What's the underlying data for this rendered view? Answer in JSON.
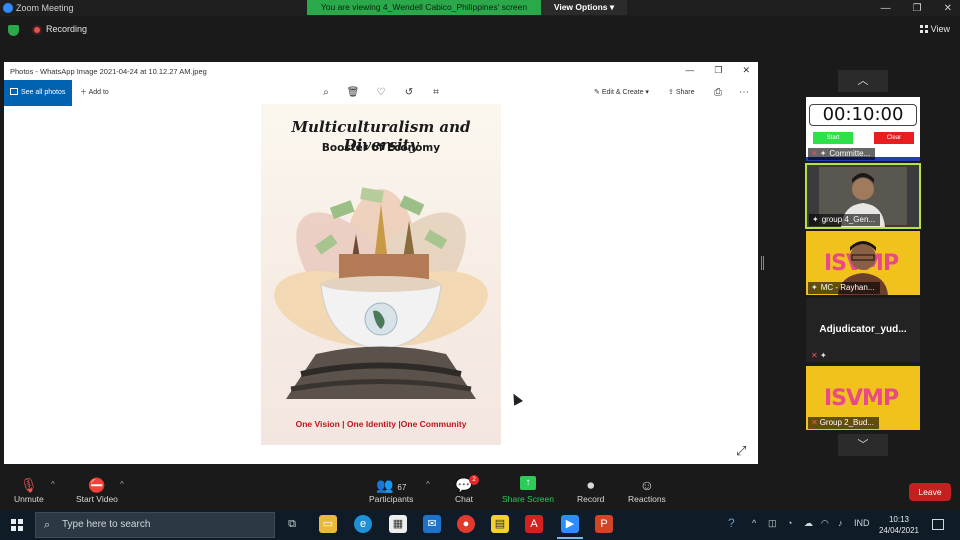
{
  "zoom": {
    "window_title": "Zoom Meeting",
    "viewing_banner": "You are viewing 4_Wendell Cabico_Philippines' screen",
    "view_options_label": "View Options",
    "recording_label": "Recording",
    "view_label": "View"
  },
  "photos": {
    "title": "Photos - WhatsApp Image 2021-04-24 at 10.12.27 AM.jpeg",
    "see_all_label": "See all photos",
    "add_to_label": "Add to",
    "edit_create_label": "Edit & Create",
    "share_label": "Share",
    "poster": {
      "title": "Multiculturalism and Diversity",
      "subtitle": "Booster of Economy",
      "footer": "One Vision | One Identity |One Community"
    }
  },
  "tiles": [
    {
      "name": "Committe...",
      "timer": "00:10:00",
      "start_label": "Start",
      "clear_label": "Clear"
    },
    {
      "name": "group 4_Gen..."
    },
    {
      "name": "MC - Rayhan..."
    },
    {
      "name": "Adjudicator_yud..."
    },
    {
      "name": "Group 2_Bud..."
    }
  ],
  "controls": {
    "unmute": "Unmute",
    "start_video": "Start Video",
    "participants": "Participants",
    "participants_count": "67",
    "chat": "Chat",
    "chat_badge": "2",
    "share_screen": "Share Screen",
    "record": "Record",
    "reactions": "Reactions",
    "leave": "Leave"
  },
  "taskbar": {
    "search_placeholder": "Type here to search",
    "language": "IND",
    "time": "10:13",
    "date": "24/04/2021"
  }
}
